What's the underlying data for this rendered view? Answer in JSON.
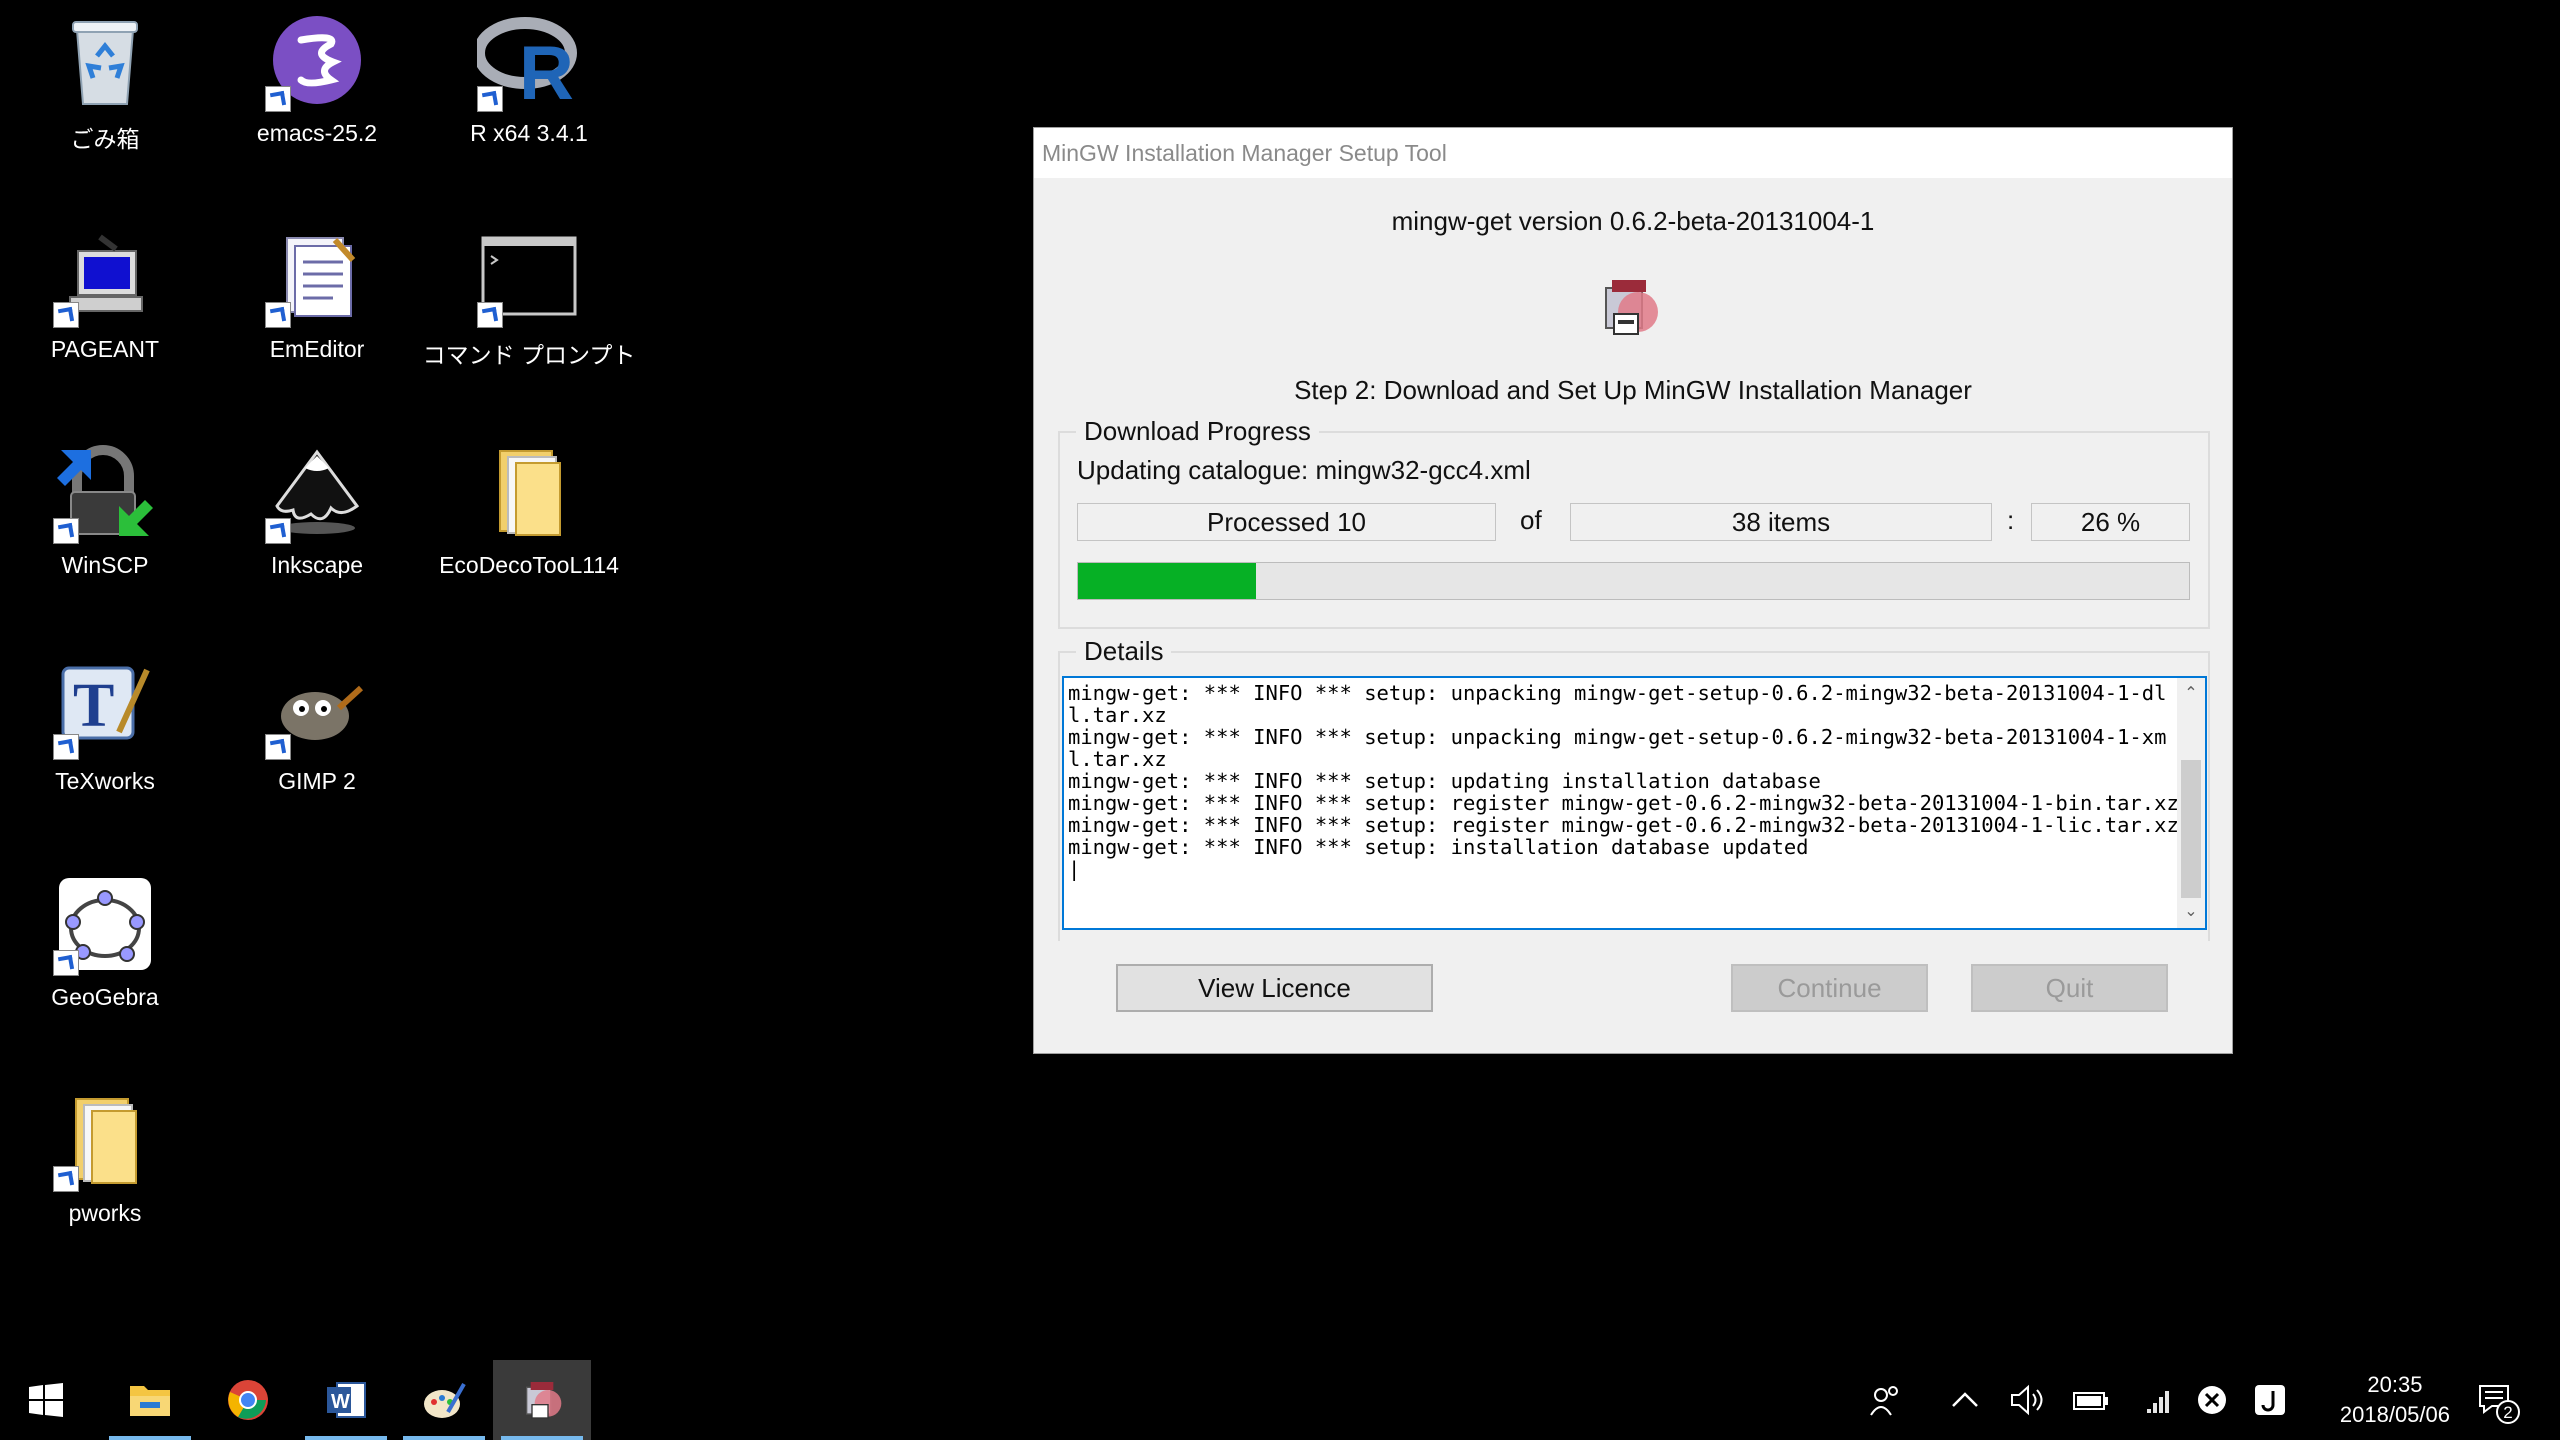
{
  "desktop": {
    "icons": [
      {
        "label": "ごみ箱",
        "icon": "recycle-bin-icon"
      },
      {
        "label": "emacs-25.2",
        "icon": "emacs-icon"
      },
      {
        "label": "R x64 3.4.1",
        "icon": "r-icon"
      },
      {
        "label": "PAGEANT",
        "icon": "pageant-icon"
      },
      {
        "label": "EmEditor",
        "icon": "emeditor-icon"
      },
      {
        "label": "コマンド プロンプト",
        "icon": "command-prompt-icon"
      },
      {
        "label": "WinSCP",
        "icon": "winscp-icon"
      },
      {
        "label": "Inkscape",
        "icon": "inkscape-icon"
      },
      {
        "label": "EcoDecoTooL114",
        "icon": "folder-icon"
      },
      {
        "label": "TeXworks",
        "icon": "texworks-icon"
      },
      {
        "label": "GIMP 2",
        "icon": "gimp-icon"
      },
      {
        "label": "GeoGebra",
        "icon": "geogebra-icon"
      },
      {
        "label": "pworks",
        "icon": "folder-icon"
      }
    ]
  },
  "dialog": {
    "title": "MinGW Installation Manager Setup Tool",
    "version_text": "mingw-get version 0.6.2-beta-20131004-1",
    "step_text": "Step 2: Download and Set Up MinGW Installation Manager",
    "download_group_title": "Download Progress",
    "updating_text": "Updating catalogue: mingw32-gcc4.xml",
    "processed_text": "Processed 10",
    "of_text": "of",
    "items_text": "38 items",
    "colon_text": ":",
    "percent_text": "26 %",
    "progress_fraction": 0.16,
    "details_group_title": "Details",
    "log_text": "mingw-get: *** INFO *** setup: unpacking mingw-get-setup-0.6.2-mingw32-beta-20131004-1-dll.tar.xz\nmingw-get: *** INFO *** setup: unpacking mingw-get-setup-0.6.2-mingw32-beta-20131004-1-xml.tar.xz\nmingw-get: *** INFO *** setup: updating installation database\nmingw-get: *** INFO *** setup: register mingw-get-0.6.2-mingw32-beta-20131004-1-bin.tar.xz\nmingw-get: *** INFO *** setup: register mingw-get-0.6.2-mingw32-beta-20131004-1-lic.tar.xz\nmingw-get: *** INFO *** setup: installation database updated\n|",
    "buttons": {
      "view_licence": "View Licence",
      "continue": "Continue",
      "quit": "Quit"
    }
  },
  "taskbar": {
    "items": [
      "start-icon",
      "file-explorer-icon",
      "chrome-icon",
      "word-icon",
      "paint-icon",
      "mingw-setup-icon"
    ],
    "clock_time": "20:35",
    "clock_date": "2018/05/06",
    "notification_count": "2",
    "accent_color": "#76b9ed"
  },
  "colors": {
    "progress_green": "#06b025",
    "focus_blue": "#0078d7"
  }
}
